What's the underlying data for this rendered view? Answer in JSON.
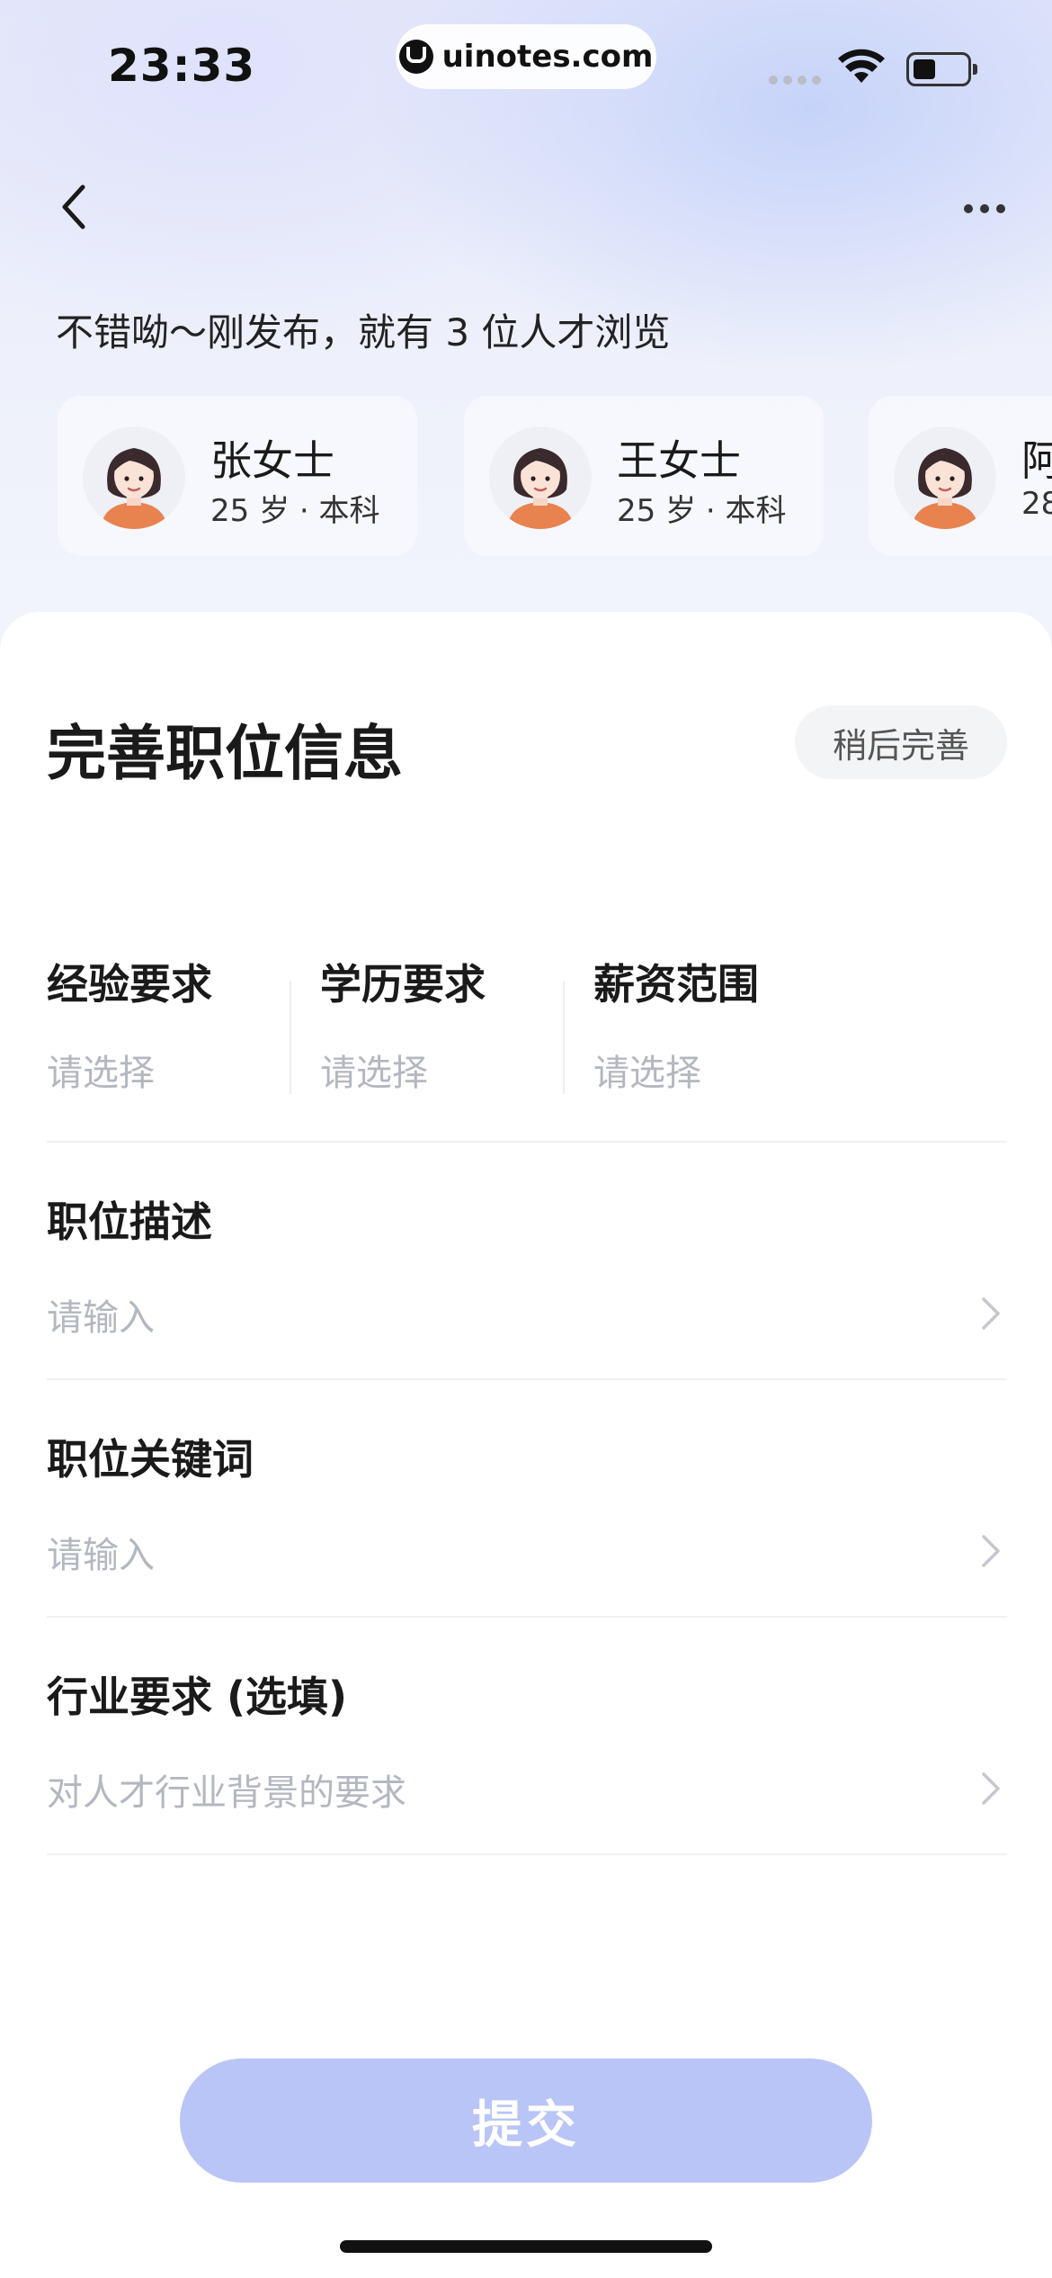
{
  "status_bar": {
    "time": "23:33",
    "url": "uinotes.com"
  },
  "nav": {
    "back_icon": "chevron-left-icon",
    "more_icon": "more-dots-icon"
  },
  "hero": {
    "message": "不错呦～刚发布，就有 3 位人才浏览",
    "candidates": [
      {
        "name": "张女士",
        "meta": "25 岁 · 本科"
      },
      {
        "name": "王女士",
        "meta": "25 岁 · 本科"
      },
      {
        "name": "阿",
        "meta": "28"
      }
    ]
  },
  "sheet": {
    "title": "完善职位信息",
    "later_label": "稍后完善",
    "requirements": [
      {
        "label": "经验要求",
        "value": "请选择"
      },
      {
        "label": "学历要求",
        "value": "请选择"
      },
      {
        "label": "薪资范围",
        "value": "请选择"
      }
    ],
    "fields": [
      {
        "label": "职位描述",
        "placeholder": "请输入"
      },
      {
        "label": "职位关键词",
        "placeholder": "请输入"
      },
      {
        "label": "行业要求 (选填)",
        "placeholder": "对人才行业背景的要求"
      }
    ],
    "submit_label": "提交"
  },
  "colors": {
    "accent_disabled": "#b9c5f6",
    "placeholder": "#b3b7bf",
    "avatar_shirt": "#e8824f"
  }
}
